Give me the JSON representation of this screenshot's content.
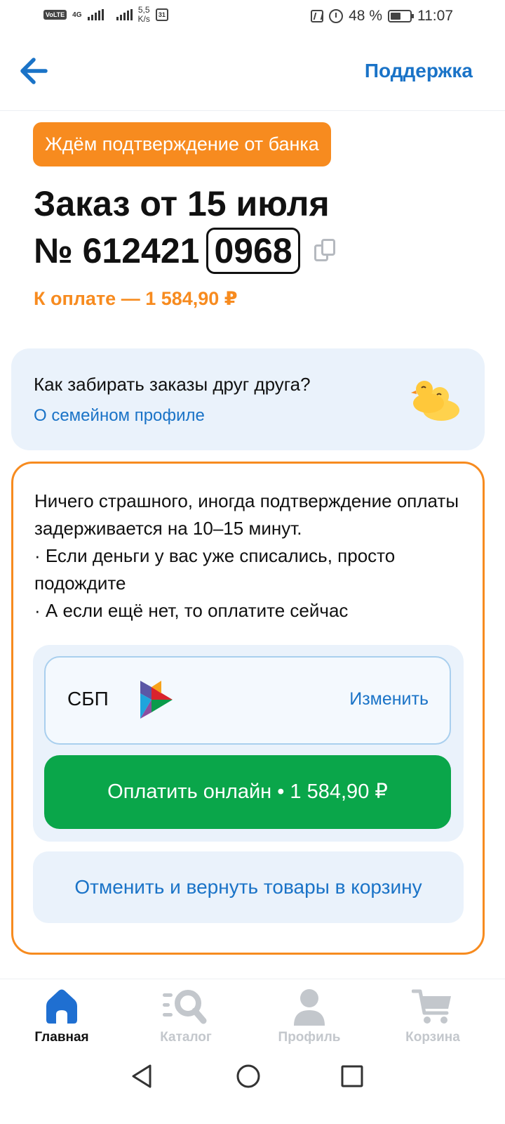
{
  "status_bar": {
    "volte": "VoLTE",
    "network": "4G",
    "speed_value": "5,5",
    "speed_unit": "K/s",
    "calendar_day": "31",
    "battery_pct": "48 %",
    "time": "11:07"
  },
  "header": {
    "back_icon": "arrow-left-icon",
    "support_label": "Поддержка"
  },
  "order": {
    "status_badge": "Ждём подтверждение от банка",
    "title": "Заказ от 15 июля",
    "number_prefix": "№ 612421",
    "number_highlight": "0968",
    "amount_due": "К оплате — 1 584,90 ₽"
  },
  "family_card": {
    "question": "Как забирать заказы друг друга?",
    "link": "О семейном профиле",
    "icon": "ducks-icon"
  },
  "info_card": {
    "lines": [
      "Ничего страшного, иногда подтверждение оплаты задерживается на 10–15 минут.",
      " · Если деньги у вас уже списались, просто подождите",
      " · А если ещё нет, то оплатите сейчас"
    ],
    "payment_method": {
      "name": "СБП",
      "icon": "sbp-logo-icon",
      "change_label": "Изменить"
    },
    "pay_button": "Оплатить онлайн • 1 584,90 ₽",
    "cancel_button": "Отменить и вернуть товары в корзину"
  },
  "bottom_nav": {
    "items": [
      {
        "label": "Главная",
        "icon": "home-icon",
        "active": true
      },
      {
        "label": "Каталог",
        "icon": "catalog-search-icon",
        "active": false
      },
      {
        "label": "Профиль",
        "icon": "profile-icon",
        "active": false
      },
      {
        "label": "Корзина",
        "icon": "cart-icon",
        "active": false
      }
    ]
  },
  "colors": {
    "accent_orange": "#f78b1f",
    "link_blue": "#1a73c7",
    "pay_green": "#0aa64a",
    "card_bg": "#eaf2fb"
  }
}
